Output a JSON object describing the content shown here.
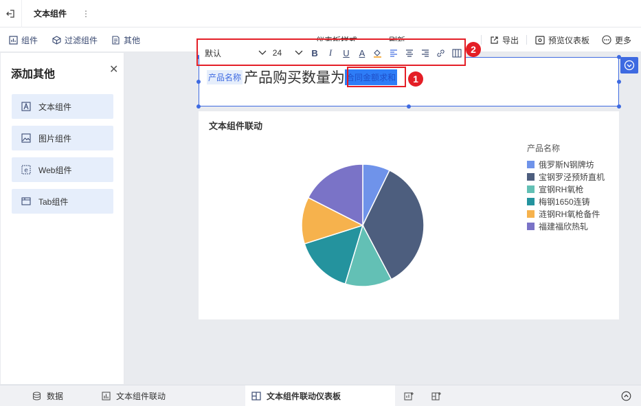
{
  "header": {
    "title": "文本组件",
    "menu_glyph": "⋮"
  },
  "toolbar": {
    "left_items": [
      "组件",
      "过滤组件",
      "其他"
    ],
    "right_items": [
      "仪表板样式",
      "刷新",
      "导出",
      "预览仪表板",
      "更多"
    ]
  },
  "side_panel": {
    "title": "添加其他",
    "items": [
      "文本组件",
      "图片组件",
      "Web组件",
      "Tab组件"
    ]
  },
  "text_component": {
    "field_chip": "产品名称",
    "text": "产品购买数量为",
    "selected_field": "合同金额求和"
  },
  "format_bar": {
    "font": "默认",
    "size": "24"
  },
  "markers": [
    "1",
    "2"
  ],
  "chart_data": {
    "type": "pie",
    "title": "文本组件联动",
    "legend_title": "产品名称",
    "legend_position": "right",
    "categories": [
      "俄罗斯N钢牌坊",
      "宝钢罗泾预矫直机",
      "宣钢RH氧枪",
      "梅钢1650连铸",
      "涟钢RH氧枪备件",
      "福建福欣热轧"
    ],
    "values": [
      7,
      34,
      12,
      15,
      12,
      17
    ],
    "colors": [
      "#6f93ea",
      "#4d5e7e",
      "#63c0b5",
      "#24939e",
      "#f6b24d",
      "#7a73c7"
    ]
  },
  "bottom_tabs": [
    "数据",
    "文本组件联动",
    "文本组件联动仪表板"
  ]
}
